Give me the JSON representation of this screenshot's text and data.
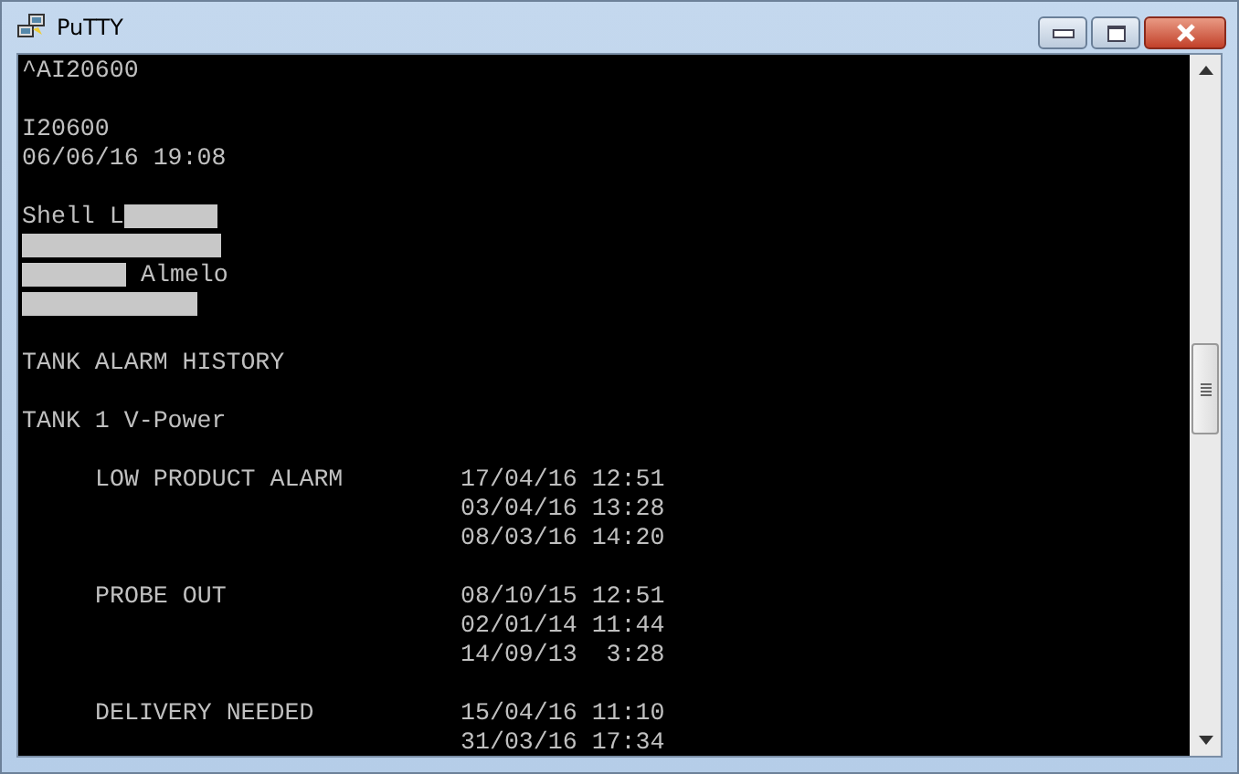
{
  "window": {
    "title": "PuTTY"
  },
  "terminal": {
    "lines": [
      {
        "kind": "plain",
        "text": "^AI20600"
      },
      {
        "kind": "blank"
      },
      {
        "kind": "plain",
        "text": "I20600"
      },
      {
        "kind": "plain",
        "text": "06/06/16 19:08"
      },
      {
        "kind": "blank"
      },
      {
        "kind": "plain",
        "text": "Shell L",
        "mask": {
          "kind": "short"
        }
      },
      {
        "kind": "redacted",
        "mask": {
          "kind": "long"
        }
      },
      {
        "kind": "redacted",
        "mask": {
          "kind": "medium"
        },
        "text_after": "Almelo"
      },
      {
        "kind": "redacted",
        "mask": {
          "kind": "wide"
        }
      },
      {
        "kind": "blank"
      },
      {
        "kind": "plain",
        "text": "TANK ALARM HISTORY"
      },
      {
        "kind": "blank"
      },
      {
        "kind": "plain",
        "text": "TANK 1 V-Power"
      },
      {
        "kind": "blank"
      },
      {
        "kind": "alarm",
        "event": "LOW PRODUCT ALARM",
        "time": "17/04/16 12:51"
      },
      {
        "kind": "alarm",
        "time": "03/04/16 13:28"
      },
      {
        "kind": "alarm",
        "time": "08/03/16 14:20"
      },
      {
        "kind": "blank"
      },
      {
        "kind": "alarm",
        "event": "PROBE OUT",
        "time": "08/10/15 12:51"
      },
      {
        "kind": "alarm",
        "time": "02/01/14 11:44"
      },
      {
        "kind": "alarm",
        "time": "14/09/13  3:28"
      },
      {
        "kind": "blank"
      },
      {
        "kind": "alarm",
        "event": "DELIVERY NEEDED",
        "time": "15/04/16 11:10"
      },
      {
        "kind": "alarm",
        "time": "31/03/16 17:34"
      }
    ]
  }
}
